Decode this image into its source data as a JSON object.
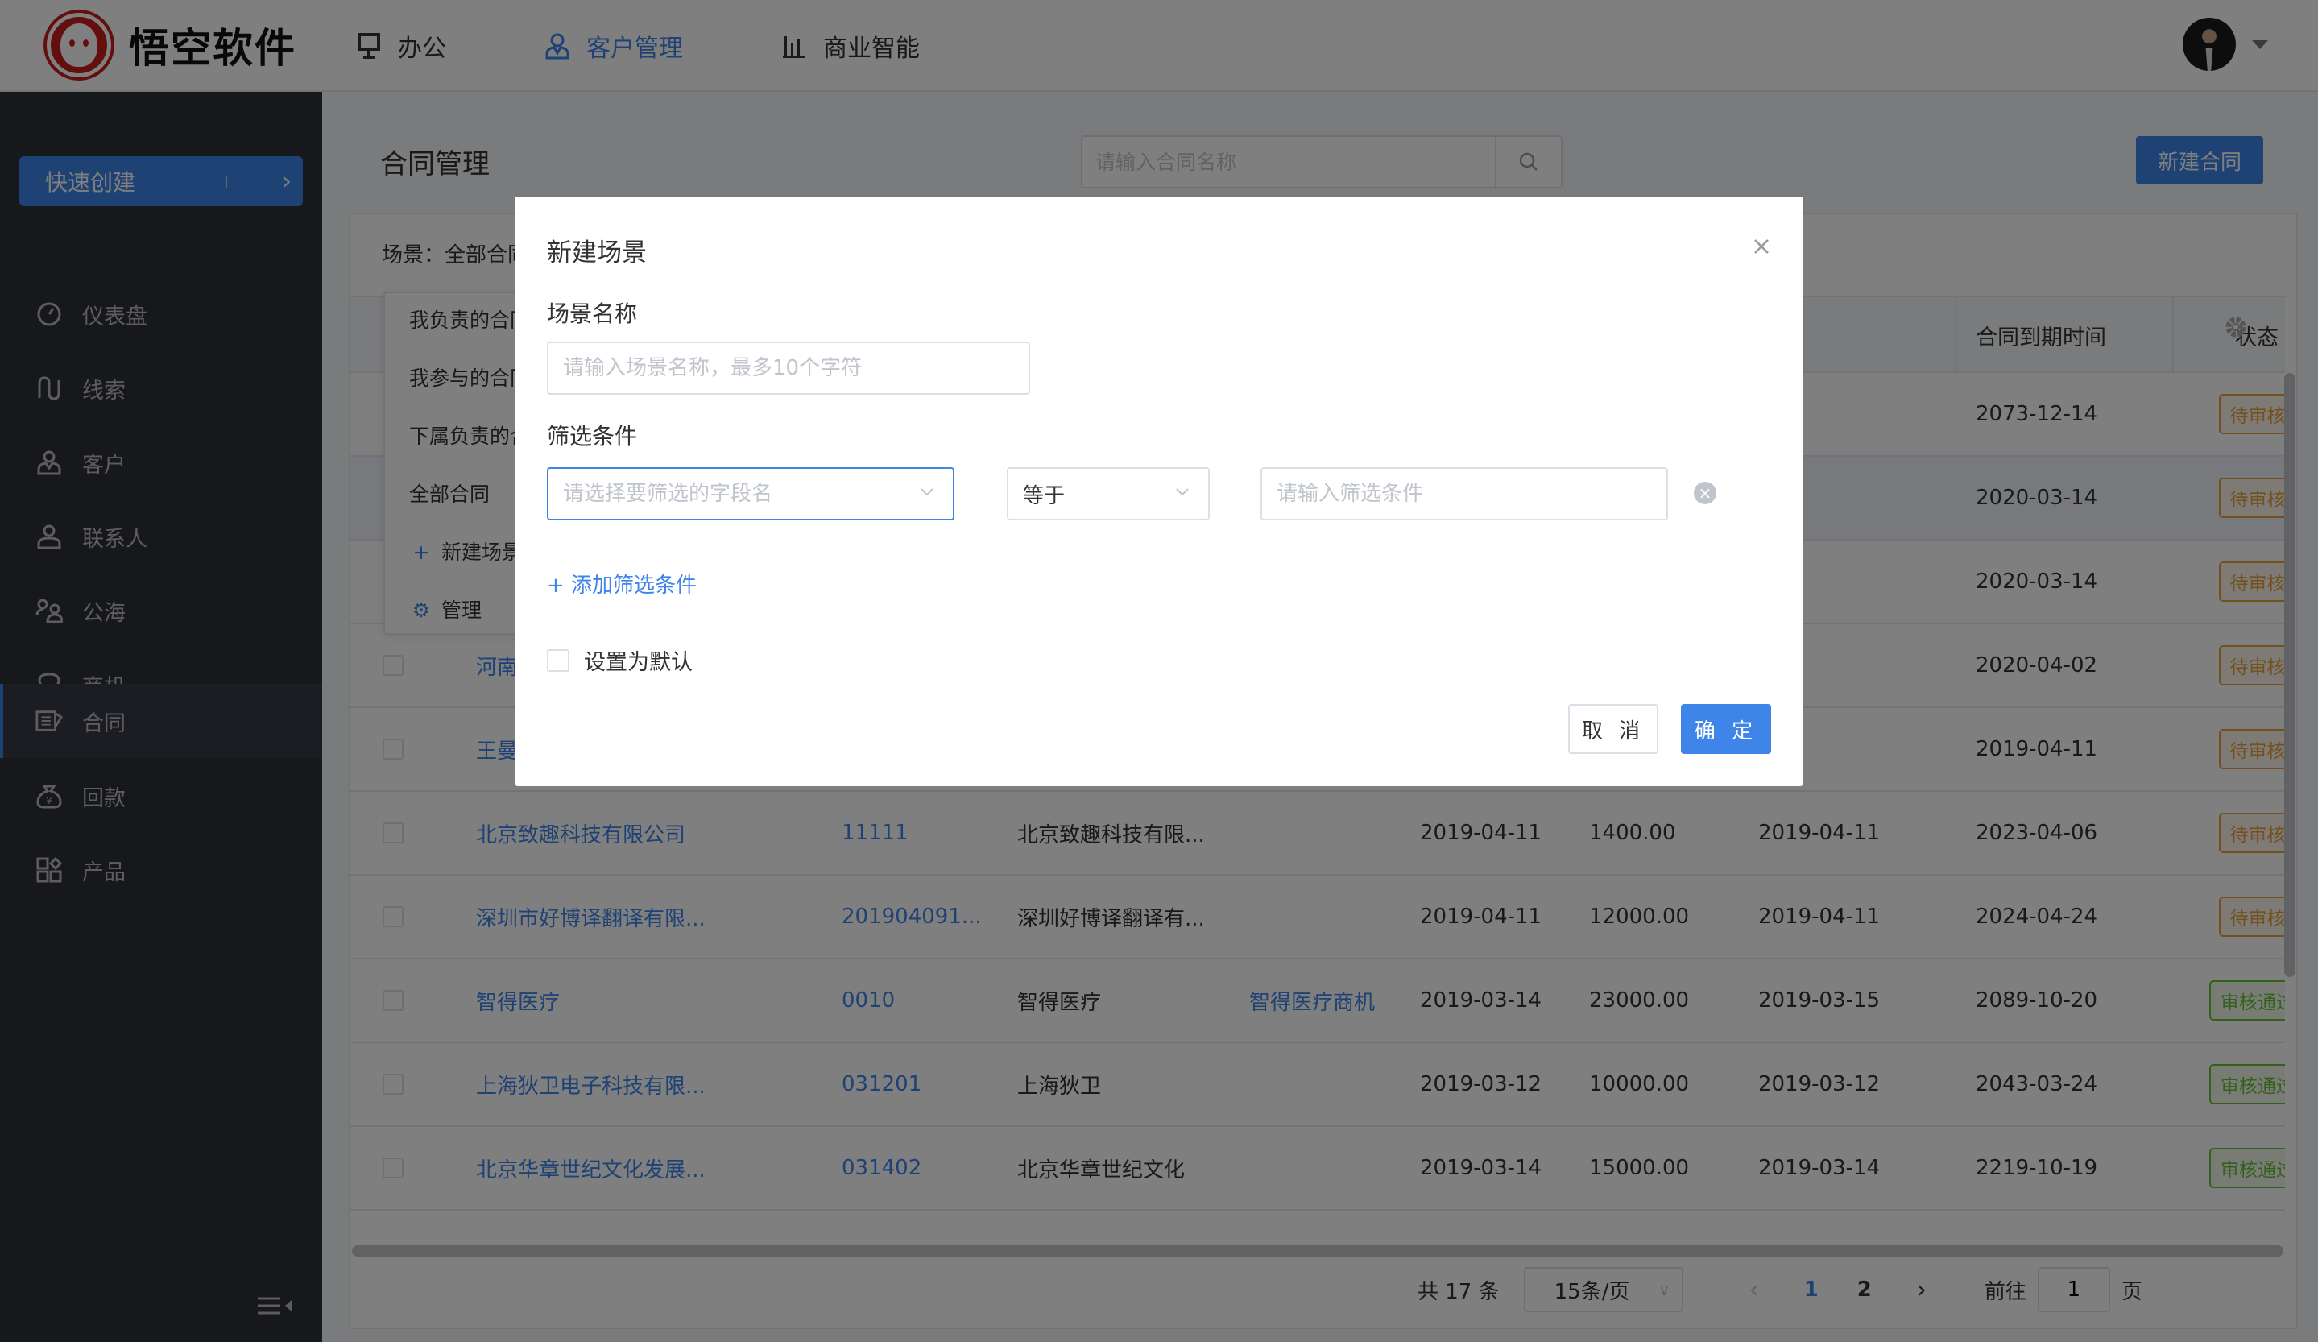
{
  "app": {
    "logo_text": "悟空软件",
    "top_nav": [
      {
        "label": "办公",
        "icon": "monitor-icon",
        "active": false
      },
      {
        "label": "客户管理",
        "icon": "user-icon",
        "active": true
      },
      {
        "label": "商业智能",
        "icon": "bar-chart-icon",
        "active": false
      }
    ],
    "accent_color": "#3e84e9"
  },
  "sidebar": {
    "quick_create_label": "快速创建",
    "items": [
      {
        "label": "仪表盘",
        "icon": "dashboard-icon"
      },
      {
        "label": "线索",
        "icon": "clue-icon"
      },
      {
        "label": "客户",
        "icon": "customer-icon"
      },
      {
        "label": "联系人",
        "icon": "contact-icon"
      },
      {
        "label": "公海",
        "icon": "pool-icon"
      },
      {
        "label": "商机",
        "icon": "lightbulb-icon"
      },
      {
        "label": "合同",
        "icon": "contract-icon",
        "active": true
      },
      {
        "label": "回款",
        "icon": "money-bag-icon"
      },
      {
        "label": "产品",
        "icon": "product-icon"
      }
    ]
  },
  "main": {
    "page_title": "合同管理",
    "search_placeholder": "请输入合同名称",
    "new_button_label": "新建合同",
    "scene_label": "场景：全部合同",
    "scene_menu": [
      "我负责的合同",
      "我参与的合同",
      "下属负责的合同",
      "全部合同"
    ],
    "scene_menu_new": "新建场景",
    "scene_menu_manage": "管理",
    "table": {
      "headers": {
        "expire": "合同到期时间",
        "status": "状态"
      },
      "rows": [
        {
          "customer": "",
          "number": "",
          "name": "",
          "opportunity": "",
          "order_date": "",
          "amount": "",
          "start": "",
          "expire": "2073-12-14",
          "status": "待审核",
          "status_type": "pending"
        },
        {
          "customer": "",
          "number": "",
          "name": "",
          "opportunity": "",
          "order_date": "",
          "amount": "",
          "start": "",
          "expire": "2020-03-14",
          "status": "待审核",
          "status_type": "pending"
        },
        {
          "customer": "",
          "number": "",
          "name": "",
          "opportunity": "",
          "order_date": "",
          "amount": "",
          "start": "",
          "expire": "2020-03-14",
          "status": "待审核",
          "status_type": "pending"
        },
        {
          "customer": "河南玖",
          "number": "",
          "name": "",
          "opportunity": "",
          "order_date": "",
          "amount": "",
          "start": "",
          "expire": "2020-04-02",
          "status": "待审核",
          "status_type": "pending"
        },
        {
          "customer": "王曼曼",
          "number": "",
          "name": "",
          "opportunity": "",
          "order_date": "",
          "amount": "",
          "start": "",
          "expire": "2019-04-11",
          "status": "待审核",
          "status_type": "pending"
        },
        {
          "customer": "北京致趣科技有限公司",
          "number": "11111",
          "name": "北京致趣科技有限...",
          "opportunity": "",
          "order_date": "2019-04-11",
          "amount": "1400.00",
          "start": "2019-04-11",
          "expire": "2023-04-06",
          "status": "待审核",
          "status_type": "pending"
        },
        {
          "customer": "深圳市好博译翻译有限...",
          "number": "201904091...",
          "name": "深圳好博译翻译有...",
          "opportunity": "",
          "order_date": "2019-04-11",
          "amount": "12000.00",
          "start": "2019-04-11",
          "expire": "2024-04-24",
          "status": "待审核",
          "status_type": "pending"
        },
        {
          "customer": "智得医疗",
          "number": "0010",
          "name": "智得医疗",
          "opportunity": "智得医疗商机",
          "order_date": "2019-03-14",
          "amount": "23000.00",
          "start": "2019-03-15",
          "expire": "2089-10-20",
          "status": "审核通过",
          "status_type": "passed"
        },
        {
          "customer": "上海狄卫电子科技有限...",
          "number": "031201",
          "name": "上海狄卫",
          "opportunity": "",
          "order_date": "2019-03-12",
          "amount": "10000.00",
          "start": "2019-03-12",
          "expire": "2043-03-24",
          "status": "审核通过",
          "status_type": "passed"
        },
        {
          "customer": "北京华章世纪文化发展...",
          "number": "031402",
          "name": "北京华章世纪文化",
          "opportunity": "",
          "order_date": "2019-03-14",
          "amount": "15000.00",
          "start": "2019-03-14",
          "expire": "2219-10-19",
          "status": "审核通过",
          "status_type": "passed"
        }
      ]
    },
    "pagination": {
      "total_label": "共 17 条",
      "page_size": "15条/页",
      "pages": [
        "1",
        "2"
      ],
      "current_page": "1",
      "goto_label": "前往",
      "goto_value": "1",
      "page_suffix": "页"
    }
  },
  "modal": {
    "title": "新建场景",
    "name_label": "场景名称",
    "name_placeholder": "请输入场景名称，最多10个字符",
    "filter_label": "筛选条件",
    "field_placeholder": "请选择要筛选的字段名",
    "operator_value": "等于",
    "value_placeholder": "请输入筛选条件",
    "add_condition_label": "+ 添加筛选条件",
    "default_checkbox_label": "设置为默认",
    "default_checked": false,
    "cancel_label": "取 消",
    "confirm_label": "确 定"
  }
}
